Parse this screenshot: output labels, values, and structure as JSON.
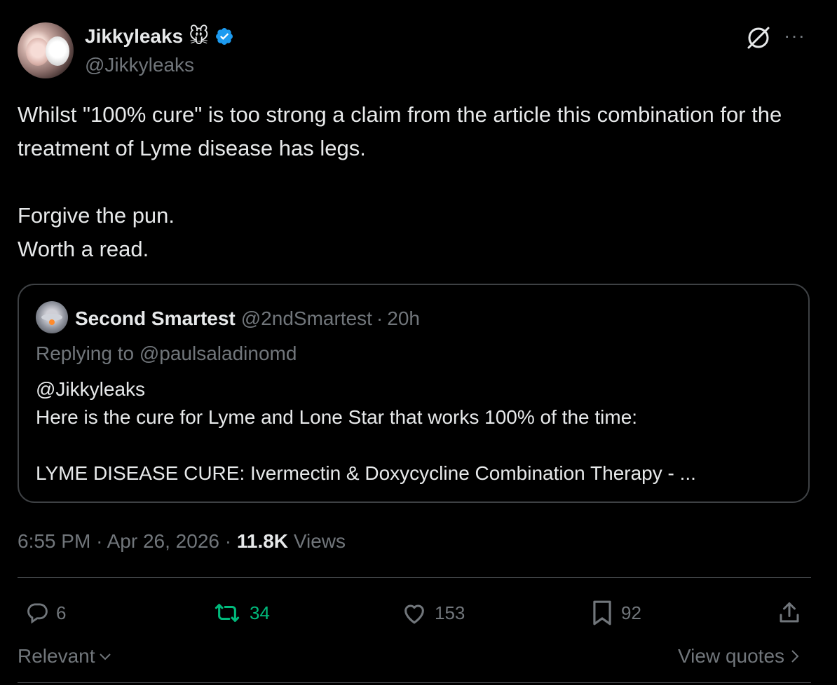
{
  "author": {
    "display_name": "Jikkyleaks",
    "emoji": "🐭",
    "handle": "@Jikkyleaks",
    "verified": true
  },
  "tweet": {
    "paragraphs": [
      "Whilst \"100% cure\" is too strong a claim from the article this combination for the treatment of Lyme disease has legs.",
      "Forgive the pun.",
      "Worth a read."
    ]
  },
  "quote": {
    "name": "Second Smartest",
    "handle": "@2ndSmartest",
    "separator": "·",
    "time": "20h",
    "replying_to": "Replying to @paulsaladinomd",
    "lines": [
      "@Jikkyleaks",
      "Here is the cure for Lyme and Lone Star that works 100% of the time:",
      "LYME DISEASE CURE: Ivermectin & Doxycycline Combination Therapy - ..."
    ]
  },
  "meta": {
    "time": "6:55 PM",
    "sep": "·",
    "date": "Apr 26, 2026",
    "views_count": "11.8K",
    "views_label": "Views"
  },
  "actions": {
    "replies": "6",
    "reposts": "34",
    "likes": "153",
    "bookmarks": "92"
  },
  "footer": {
    "sort_label": "Relevant",
    "quotes_label": "View quotes"
  },
  "colors": {
    "background": "#000000",
    "text": "#e7e9ea",
    "muted": "#71767b",
    "verified": "#1d9bf0",
    "repost_active": "#00ba7c"
  }
}
